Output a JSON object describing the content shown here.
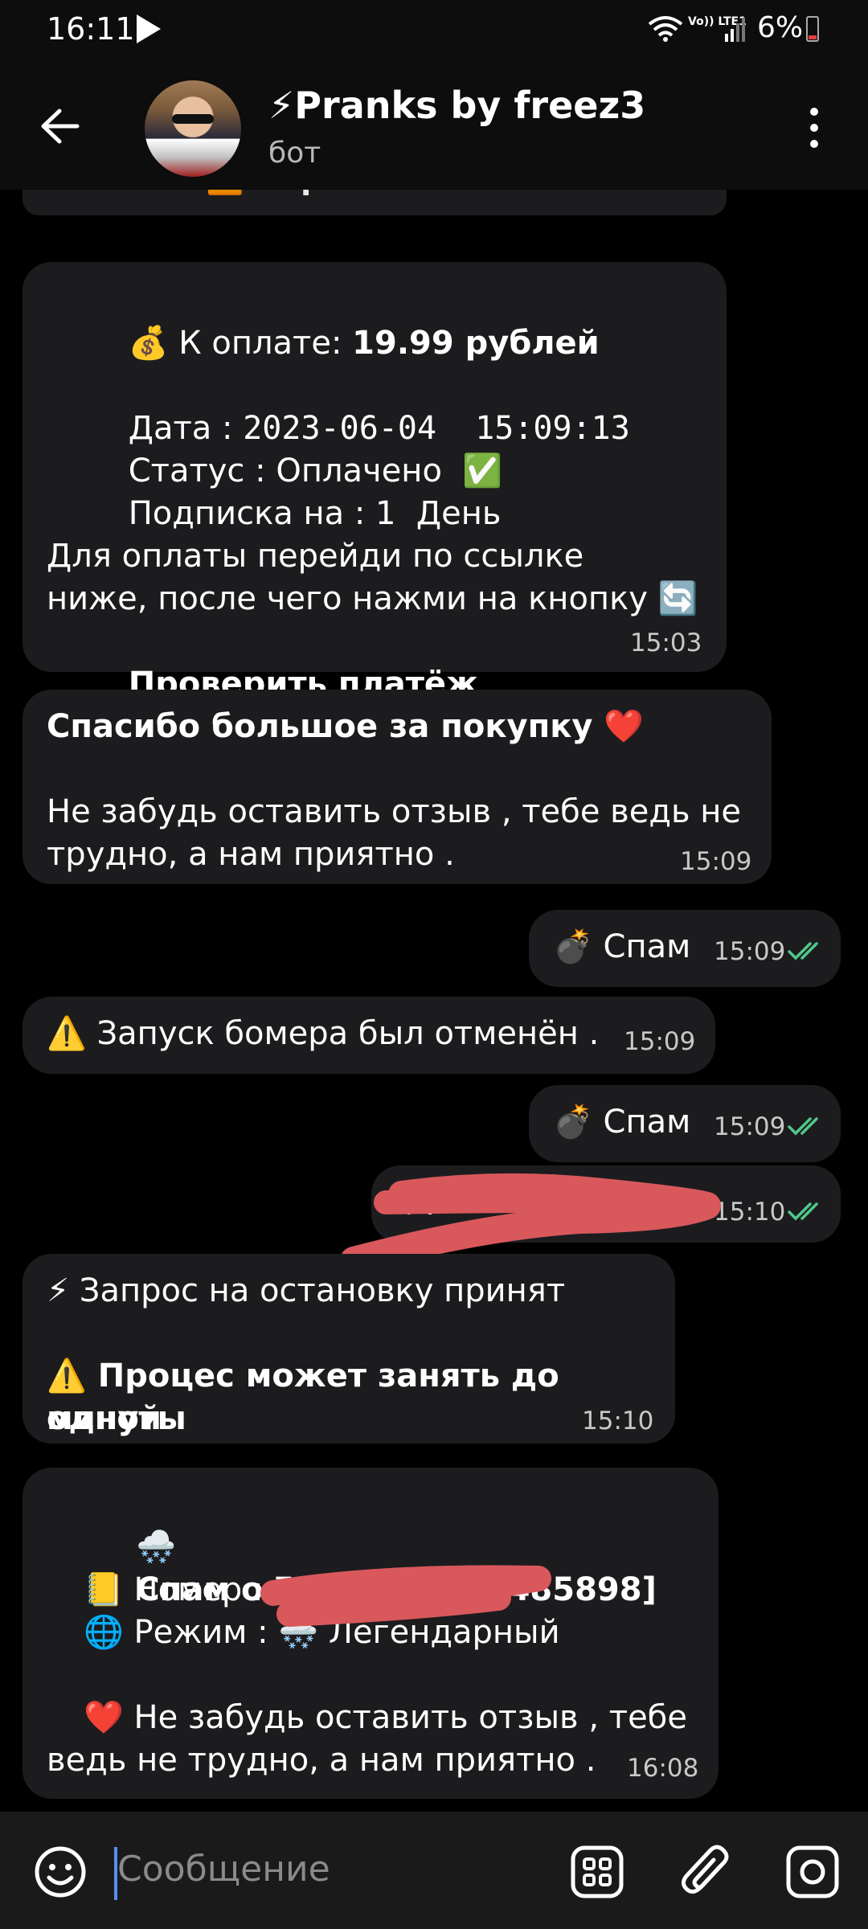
{
  "status_bar": {
    "time": "16:11",
    "network": "Vo)) LTE1",
    "battery": "6%"
  },
  "header": {
    "title": "⚡Pranks by freez3",
    "subtitle": "бот"
  },
  "messages": {
    "pay_link_button": "▶️ Перейти к оплате",
    "invoice": {
      "amount_prefix": "💰 К оплате: ",
      "amount": "19.99 рублей",
      "date_label": "Дата : ",
      "date": "2023-06-04  15:09:13",
      "status_label": "Статус : ",
      "status": "Оплачено  ✅",
      "sub_label": "Подписка на : ",
      "sub": "1  День",
      "instr_1": "Для оплаты перейди по ссылке",
      "instr_2": "ниже, после чего нажми на кнопку 🔄",
      "instr_3": "Проверить платёж",
      "instr_3_end": ".",
      "time": "15:03"
    },
    "thanks": {
      "title": "Спасибо большое за покупку ❤️",
      "line1": "Не забудь оставить отзыв , тебе ведь не",
      "line2": "трудно, а нам приятно .",
      "time": "15:09"
    },
    "out_spam_1": {
      "text": "💣 Спам",
      "time": "15:09"
    },
    "cancelled": {
      "text": "⚠️ Запуск бомера был отменён .",
      "time": "15:09"
    },
    "out_spam_2": {
      "text": "💣 Спам",
      "time": "15:09"
    },
    "out_phone": {
      "text": "+7",
      "time": "15:10"
    },
    "stop_request": {
      "line1": "⚡ Запрос на остановку принят",
      "line2": "⚠️ Процес может занять до одной",
      "line3": "минуты",
      "time": "15:10"
    },
    "stopped": {
      "title_icon": "🌨️",
      "title": "Спам остановлен [#485898]",
      "number_label": "📒 Номер : 7",
      "mode_label": "🌐 Режим : 🌨️ Легендарный",
      "footer1": "❤️ Не забудь оставить отзыв , тебе",
      "footer2": "ведь не трудно, а нам приятно .",
      "time": "16:08"
    }
  },
  "input": {
    "placeholder": "Сообщение"
  },
  "colors": {
    "bubble": "#1c1c1e",
    "read_check": "#4fc98a",
    "redaction": "#d9585c",
    "caret": "#5b8ef0"
  }
}
